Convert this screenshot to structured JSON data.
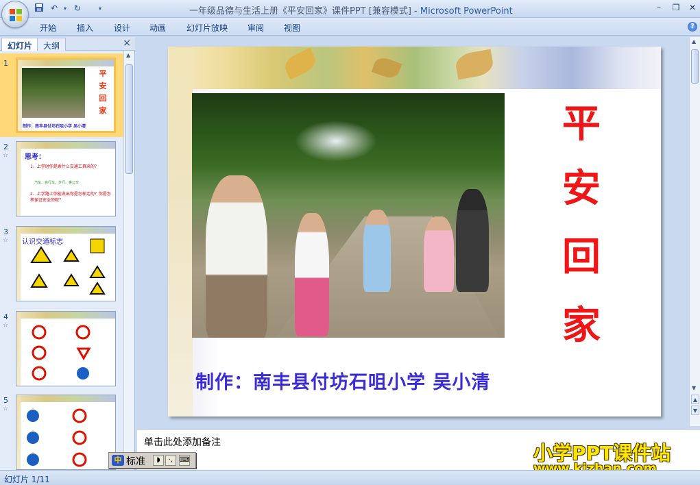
{
  "window": {
    "title": "一年级品德与生活上册《平安回家》课件PPT [兼容模式]",
    "title_separator": "-",
    "app_name": "Microsoft PowerPoint"
  },
  "quick_access": {
    "icons": [
      "save-icon",
      "undo-icon",
      "redo-icon",
      "customize-icon"
    ]
  },
  "ribbon": {
    "tabs": [
      "开始",
      "插入",
      "设计",
      "动画",
      "幻灯片放映",
      "审阅",
      "视图"
    ],
    "help": "?"
  },
  "slides_pane": {
    "tabs": [
      "幻灯片",
      "大纲"
    ],
    "active_tab": "幻灯片",
    "close": "×",
    "thumbnails": [
      {
        "number": "1",
        "title_chars": [
          "平",
          "安",
          "回",
          "家"
        ],
        "credit": "制作：南丰县付坊石咀小学 吴小清"
      },
      {
        "number": "2",
        "heading": "思考：",
        "lines": [
          "1、上学时你是乘什么交通工具来的？",
          "汽车、自行车、步行、乘公交",
          "2、上学路上你能说出你是怎样走的？你是怎样保证安全的呢？"
        ]
      },
      {
        "number": "3",
        "heading": "认识交通标志"
      },
      {
        "number": "4",
        "heading": ""
      },
      {
        "number": "5",
        "heading": ""
      }
    ]
  },
  "slide": {
    "title_chars": [
      "平",
      "安",
      "回",
      "家"
    ],
    "credit": "制作：南丰县付坊石咀小学 吴小清"
  },
  "notes": {
    "placeholder": "单击此处添加备注"
  },
  "watermark": {
    "line1": "小学PPT课件站",
    "line2": "www.kjzhan.com"
  },
  "ime": {
    "mode": "标准"
  },
  "status": {
    "slide_indicator": "幻灯片 1/11"
  }
}
